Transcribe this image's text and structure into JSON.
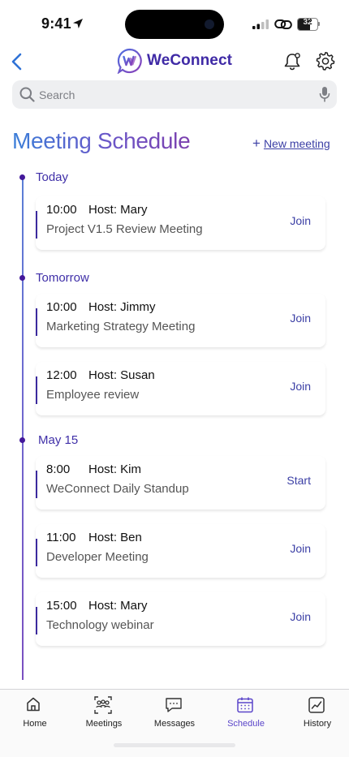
{
  "status_bar": {
    "time": "9:41",
    "battery": "32"
  },
  "header": {
    "brand_name": "WeConnect"
  },
  "search": {
    "placeholder": "Search"
  },
  "page": {
    "title": "Meeting Schedule",
    "new_meeting_label": "New meeting"
  },
  "schedule": [
    {
      "day": "Today",
      "meetings": [
        {
          "time": "10:00",
          "host": "Host: Mary",
          "title": "Project V1.5 Review Meeting",
          "action": "Join"
        }
      ]
    },
    {
      "day": "Tomorrow",
      "meetings": [
        {
          "time": "10:00",
          "host": "Host: Jimmy",
          "title": "Marketing Strategy Meeting",
          "action": "Join"
        },
        {
          "time": "12:00",
          "host": "Host: Susan",
          "title": "Employee review",
          "action": "Join"
        }
      ]
    },
    {
      "day": "May 15",
      "meetings": [
        {
          "time": "8:00",
          "host": "Host: Kim",
          "title": "WeConnect Daily Standup",
          "action": "Start"
        },
        {
          "time": "11:00",
          "host": "Host: Ben",
          "title": "Developer Meeting",
          "action": "Join"
        },
        {
          "time": "15:00",
          "host": "Host: Mary",
          "title": "Technology webinar",
          "action": "Join"
        }
      ]
    }
  ],
  "tabs": [
    {
      "label": "Home",
      "icon": "home-icon",
      "active": false
    },
    {
      "label": "Meetings",
      "icon": "meetings-icon",
      "active": false
    },
    {
      "label": "Messages",
      "icon": "messages-icon",
      "active": false
    },
    {
      "label": "Schedule",
      "icon": "calendar-icon",
      "active": true
    },
    {
      "label": "History",
      "icon": "history-chart-icon",
      "active": false
    }
  ],
  "colors": {
    "brand": "#3f2aa6",
    "accent": "#5a45c9",
    "link": "#3b3fa5"
  }
}
